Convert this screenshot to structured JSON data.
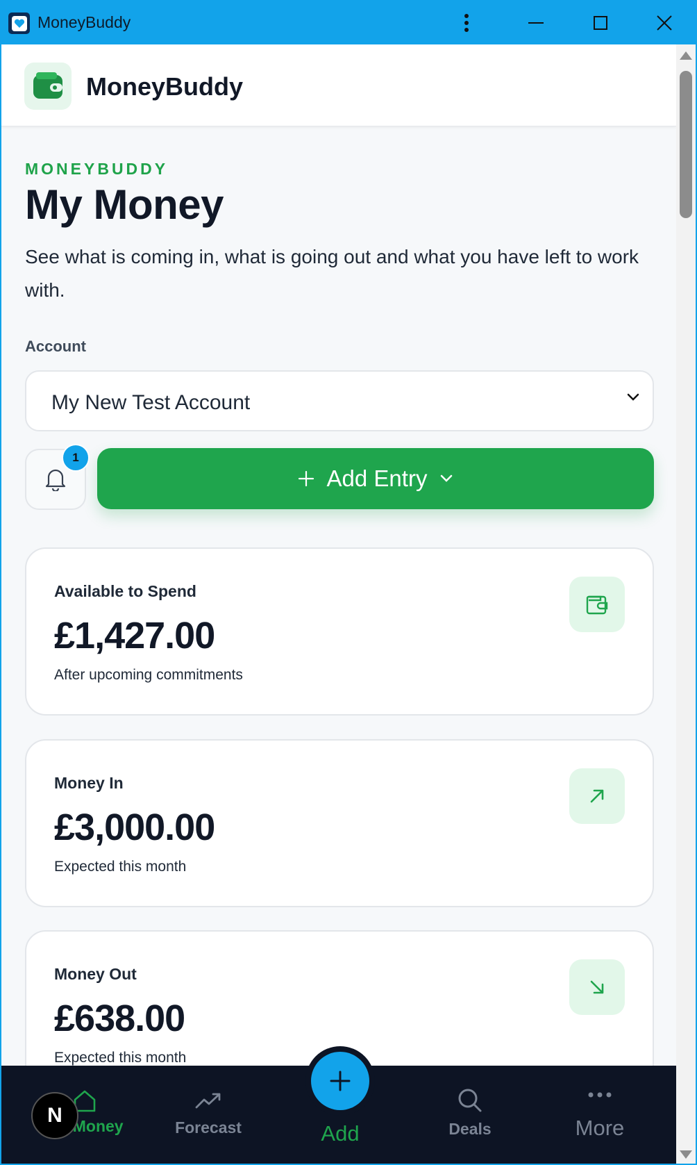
{
  "window": {
    "title": "MoneyBuddy"
  },
  "header": {
    "brand": "MoneyBuddy"
  },
  "page": {
    "eyebrow": "MONEYBUDDY",
    "title": "My Money",
    "subtitle": "See what is coming in, what is going out and what you have left to work with."
  },
  "account": {
    "label": "Account",
    "selected": "My New Test Account"
  },
  "notifications": {
    "count": "1"
  },
  "add_entry": {
    "label": "Add Entry"
  },
  "cards": [
    {
      "label": "Available to Spend",
      "value": "£1,427.00",
      "sub": "After upcoming commitments",
      "icon": "wallet-icon"
    },
    {
      "label": "Money In",
      "value": "£3,000.00",
      "sub": "Expected this month",
      "icon": "arrow-up-right-icon"
    },
    {
      "label": "Money Out",
      "value": "£638.00",
      "sub": "Expected this month",
      "icon": "arrow-down-right-icon"
    }
  ],
  "nav": {
    "my_money": "My Money",
    "forecast": "Forecast",
    "add": "Add",
    "deals": "Deals",
    "more": "More"
  },
  "dev_badge": "N",
  "colors": {
    "accent": "#1fa54d",
    "titlebar": "#12a3ea",
    "nav_bg": "#0d1424"
  }
}
